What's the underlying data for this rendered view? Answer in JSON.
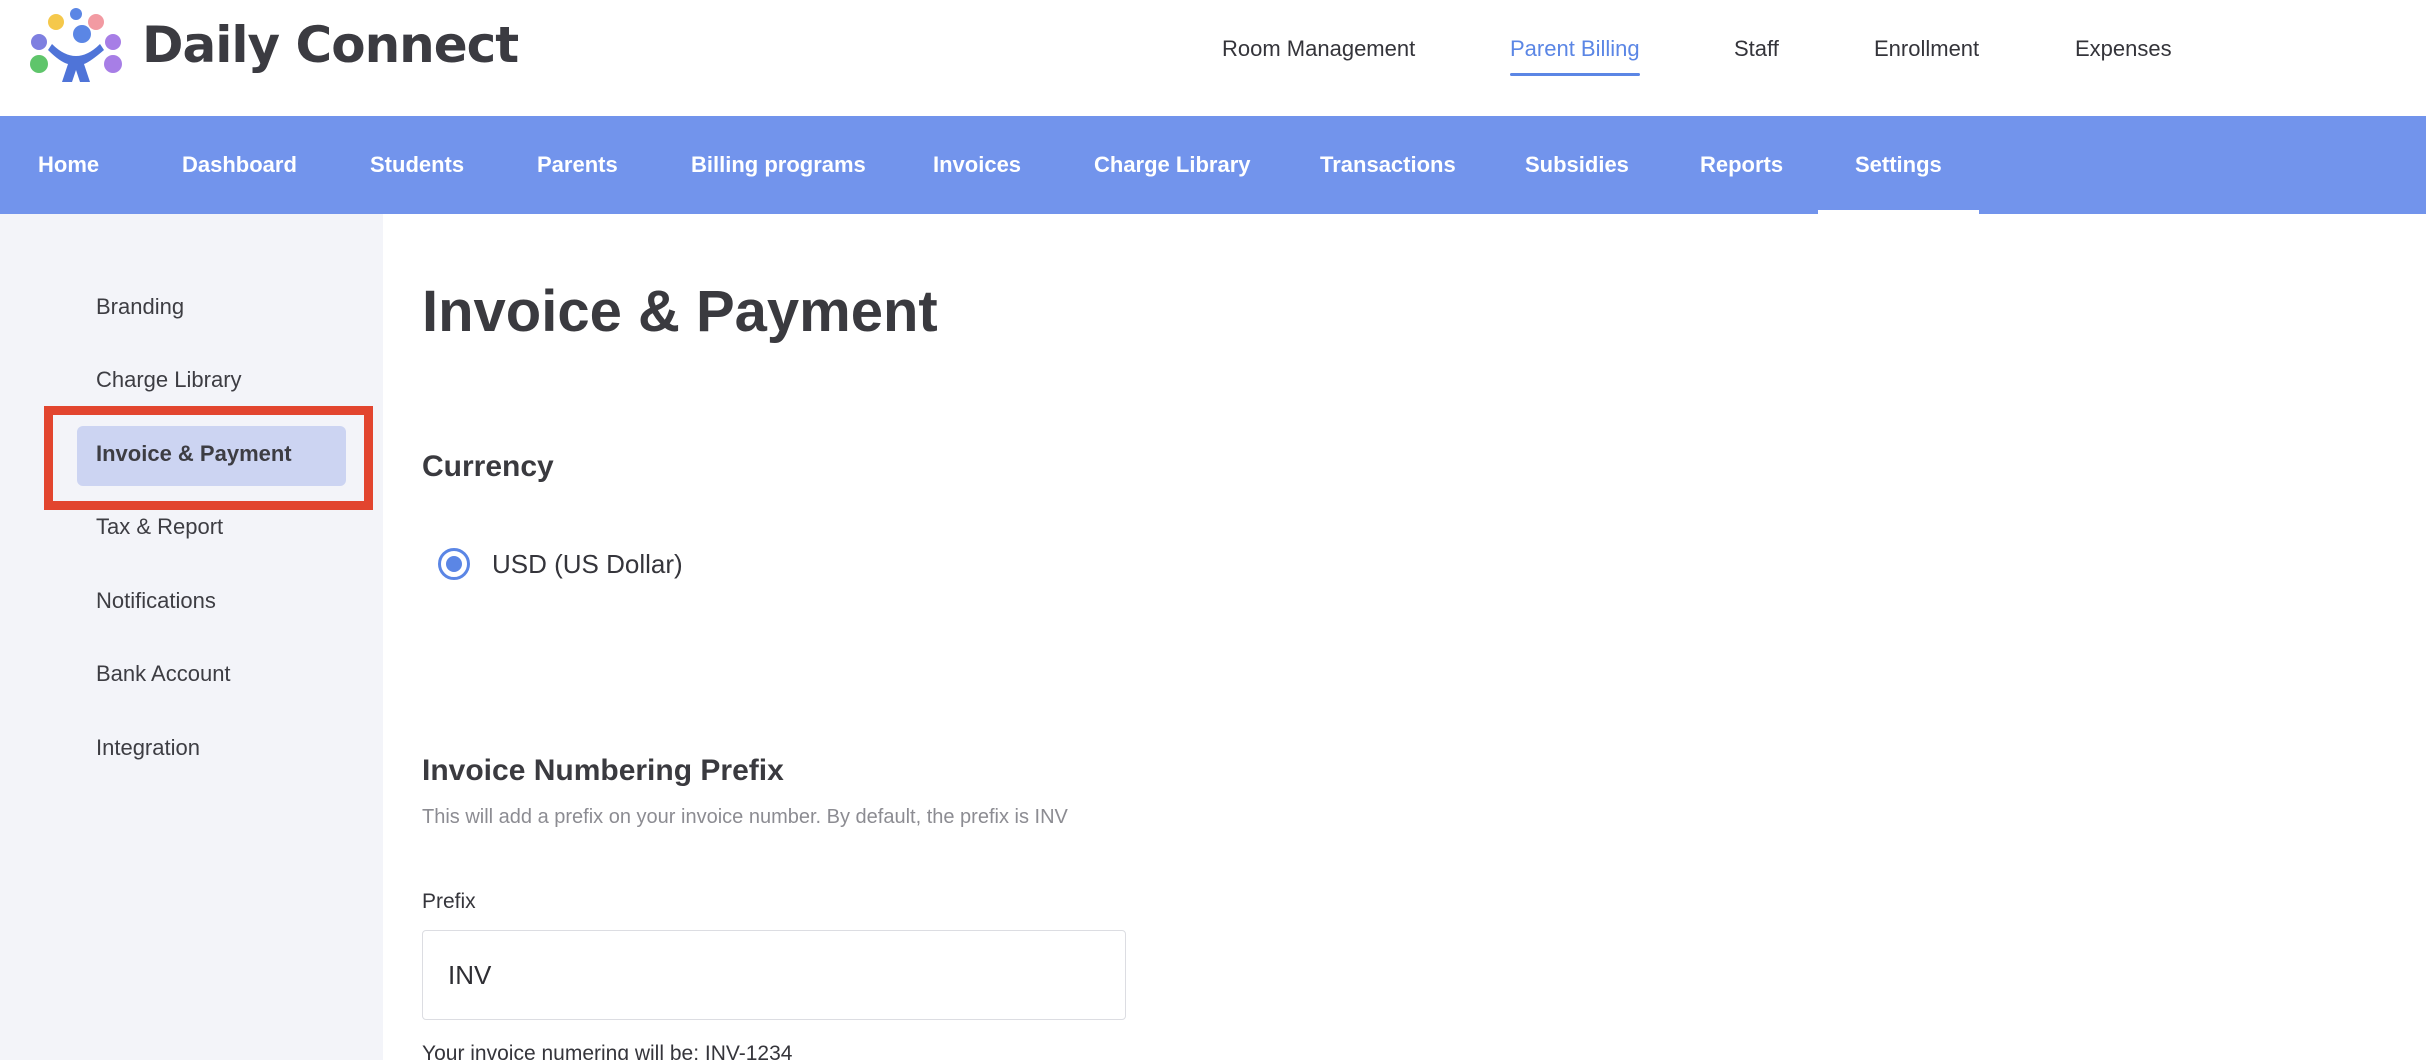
{
  "brand": {
    "name": "Daily Connect",
    "logo_icon": "daily-connect-logo-icon"
  },
  "top_nav": {
    "items": [
      {
        "label": "Room Management",
        "active": false
      },
      {
        "label": "Parent Billing",
        "active": true
      },
      {
        "label": "Staff",
        "active": false
      },
      {
        "label": "Enrollment",
        "active": false
      },
      {
        "label": "Expenses",
        "active": false
      }
    ],
    "active_color": "#5b86e5"
  },
  "main_nav": {
    "background": "#7294ec",
    "items": [
      {
        "label": "Home"
      },
      {
        "label": "Dashboard"
      },
      {
        "label": "Students"
      },
      {
        "label": "Parents"
      },
      {
        "label": "Billing programs"
      },
      {
        "label": "Invoices"
      },
      {
        "label": "Charge Library"
      },
      {
        "label": "Transactions"
      },
      {
        "label": "Subsidies"
      },
      {
        "label": "Reports"
      },
      {
        "label": "Settings",
        "active": true
      }
    ]
  },
  "sidebar": {
    "items": [
      {
        "label": "Branding"
      },
      {
        "label": "Charge Library"
      },
      {
        "label": "Invoice & Payment",
        "active": true
      },
      {
        "label": "Tax & Report"
      },
      {
        "label": "Notifications"
      },
      {
        "label": "Bank Account"
      },
      {
        "label": "Integration"
      }
    ],
    "highlight_color": "#e2452f"
  },
  "main": {
    "title": "Invoice & Payment",
    "currency": {
      "heading": "Currency",
      "option_label": "USD (US Dollar)",
      "selected": true
    },
    "prefix_section": {
      "heading": "Invoice Numbering Prefix",
      "description": "This will add a prefix on your invoice number. By default, the prefix is INV",
      "field_label": "Prefix",
      "field_value": "INV",
      "preview_text": "Your invoice numering will be: INV-1234"
    }
  }
}
